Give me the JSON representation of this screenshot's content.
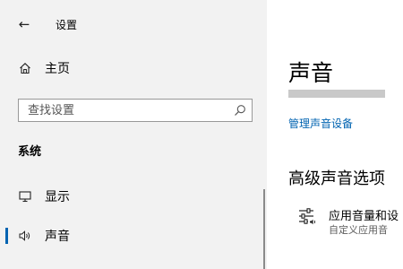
{
  "window": {
    "title": "设置",
    "back_icon": "back-arrow-icon"
  },
  "sidebar": {
    "home": {
      "label": "主页",
      "icon": "home-icon"
    },
    "search": {
      "placeholder": "查找设置",
      "icon": "search-icon"
    },
    "section_header": "系统",
    "items": [
      {
        "label": "显示",
        "icon": "monitor-icon",
        "active": false
      },
      {
        "label": "声音",
        "icon": "speaker-icon",
        "active": true
      }
    ]
  },
  "main": {
    "title": "声音",
    "manage_link": "管理声音设备",
    "advanced_section": "高级声音选项",
    "option": {
      "title": "应用音量和设",
      "subtitle": "自定义应用音",
      "icon": "mixer-sliders-icon"
    }
  },
  "colors": {
    "sidebar_bg": "#f2f2f2",
    "accent": "#0063b1",
    "link": "#0063b1"
  }
}
